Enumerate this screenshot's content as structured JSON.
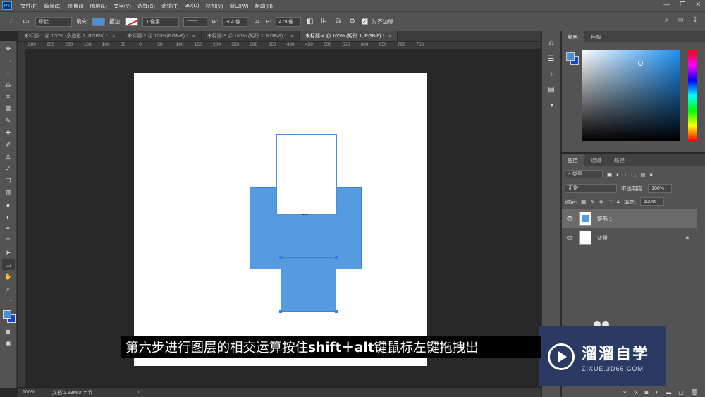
{
  "app": {
    "logo": "Ps"
  },
  "menu": [
    "文件(F)",
    "编辑(E)",
    "图像(I)",
    "图层(L)",
    "文字(Y)",
    "选择(S)",
    "滤镜(T)",
    "3D(D)",
    "视图(V)",
    "窗口(W)",
    "帮助(H)"
  ],
  "window_controls": {
    "minimize": "—",
    "restore": "❐",
    "close": "✕"
  },
  "options": {
    "mode": "形状",
    "fill_label": "填充:",
    "stroke_label": "描边:",
    "stroke_width": "1 像素",
    "w_label": "W:",
    "w_value": "304 像",
    "h_label": "H:",
    "h_value": "479 像",
    "align_edges": "对齐边缘",
    "fill_color": "#4a90d9"
  },
  "tabs": [
    {
      "label": "未标题-1 @ 100% (多边形 2, RGB/8) *",
      "close": "×"
    },
    {
      "label": "未标题-2 @ 100%(RGB/8) *",
      "close": "×"
    },
    {
      "label": "未标题-3 @ 100% (矩形 1, RGB/8) *",
      "close": "×"
    },
    {
      "label": "未标题-4 @ 100% (矩形 1, RGB/8) *",
      "close": "×"
    }
  ],
  "ruler_ticks": [
    "300",
    "250",
    "200",
    "150",
    "100",
    "50",
    "0",
    "50",
    "100",
    "150",
    "200",
    "250",
    "300",
    "350",
    "400",
    "450",
    "500",
    "550",
    "600",
    "650",
    "700",
    "750"
  ],
  "status": {
    "zoom": "100%",
    "doc": "文档:1.83M/0 字节",
    "arrow": "›"
  },
  "color_panel": {
    "tabs": [
      "颜色",
      "色板"
    ],
    "fg": "#4a90d9",
    "bg": "#1544c8"
  },
  "layers_panel": {
    "tabs": [
      "图层",
      "通道",
      "路径"
    ],
    "kind_filter": "类型",
    "blend_mode": "正常",
    "opacity_label": "不透明度:",
    "opacity_value": "100%",
    "lock_label": "锁定:",
    "fill_label": "填充:",
    "fill_value": "100%",
    "layers": [
      {
        "name": "矩形 1",
        "selected": true
      },
      {
        "name": "背景",
        "selected": false,
        "locked": true
      }
    ]
  },
  "subtitle": {
    "part1": "第六步进行图层的相交运算按住",
    "part2": "shift＋alt",
    "part3": "键鼠标左键拖拽出"
  },
  "watermark": {
    "cn": "溜溜自学",
    "en": "ZIXUE.3D66.COM"
  }
}
